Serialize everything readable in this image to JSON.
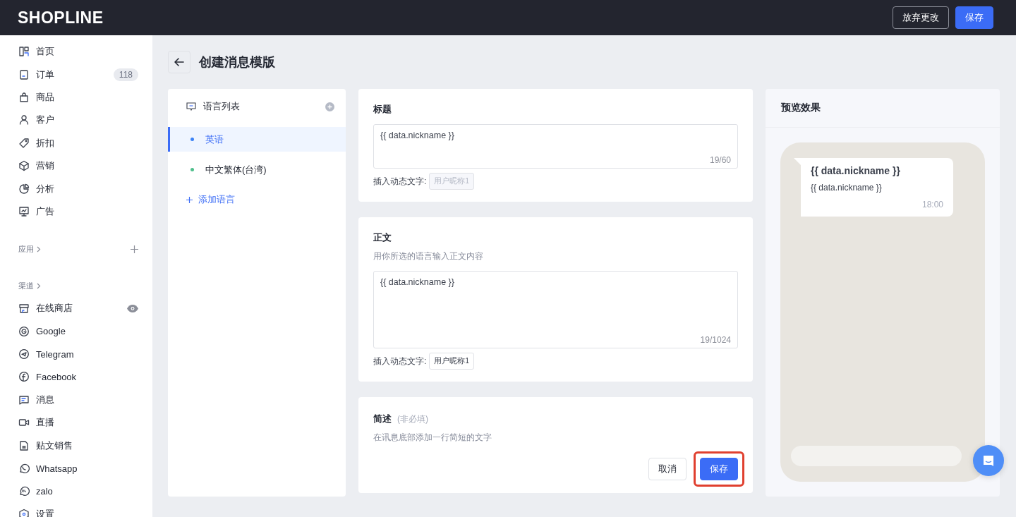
{
  "topbar": {
    "logo": "SHOPLINE",
    "buttons": [
      {
        "label": "放弃更改",
        "kind": "secondary"
      },
      {
        "label": "保存",
        "kind": "primary"
      }
    ]
  },
  "sidebar": {
    "items": [
      {
        "label": "首页"
      },
      {
        "label": "订单",
        "badge": "118"
      },
      {
        "label": "商品"
      },
      {
        "label": "客户"
      },
      {
        "label": "折扣"
      },
      {
        "label": "营销"
      },
      {
        "label": "分析"
      },
      {
        "label": "广告"
      }
    ],
    "apps_section": {
      "label": "应用"
    },
    "channels_section": {
      "label": "渠道",
      "items": [
        {
          "label": "在线商店",
          "preview_toggle": true
        },
        {
          "label": "Google",
          "preview_toggle": false
        },
        {
          "label": "Telegram",
          "preview_toggle": false
        },
        {
          "label": "Facebook",
          "preview_toggle": false
        },
        {
          "label": "消息",
          "preview_toggle": false
        },
        {
          "label": "直播",
          "preview_toggle": false
        },
        {
          "label": "贴文销售",
          "preview_toggle": false
        },
        {
          "label": "Whatsapp",
          "preview_toggle": false
        },
        {
          "label": "zalo",
          "preview_toggle": false
        },
        {
          "label": "设置",
          "preview_toggle": false
        }
      ]
    }
  },
  "page": {
    "title": "创建消息模版"
  },
  "languages": {
    "title": "语言列表",
    "items": [
      {
        "label": "英语",
        "selected": true,
        "color": "#3b82f6"
      },
      {
        "label": "中文繁体(台湾)",
        "selected": false,
        "color": "#4fbf8c"
      }
    ],
    "add_label": "添加语言"
  },
  "title_field": {
    "label": "标题",
    "value": "{{ data.nickname }}",
    "counter": "19/60",
    "insert_label": "插入动态文字:",
    "tags": [
      {
        "label": "用户昵称1",
        "disabled": true
      }
    ]
  },
  "body_field": {
    "label": "正文",
    "hint": "用你所选的语言输入正文内容",
    "value": "{{ data.nickname }}",
    "counter": "19/1024",
    "insert_label": "插入动态文字:",
    "tags": [
      {
        "label": "用户昵称1",
        "disabled": false
      }
    ]
  },
  "summary": {
    "label": "简述",
    "optional": "(非必填)",
    "hint": "在讯息底部添加一行简短的文字",
    "buttons": [
      {
        "label": "取消",
        "kind": "secondary",
        "highlighted": false
      },
      {
        "label": "保存",
        "kind": "primary",
        "highlighted": true
      }
    ]
  },
  "preview": {
    "title": "预览效果",
    "message": {
      "title": "{{ data.nickname }}",
      "body": "{{ data.nickname }}",
      "time": "18:00"
    }
  }
}
